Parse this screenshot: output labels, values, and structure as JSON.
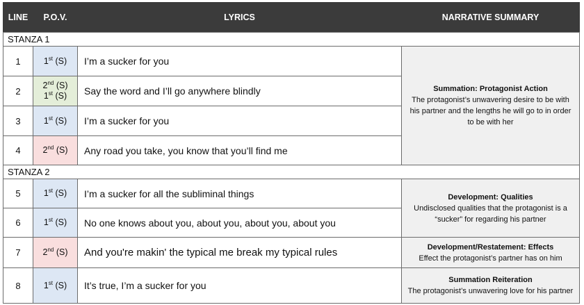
{
  "headers": {
    "line": "LINE",
    "pov": "P.O.V.",
    "lyrics": "LYRICS",
    "summary": "NARRATIVE SUMMARY"
  },
  "stanzas": [
    {
      "label": "STANZA 1"
    },
    {
      "label": "STANZA 2"
    }
  ],
  "rows": [
    {
      "num": "1",
      "pov": [
        {
          "n": "1",
          "sup": "st",
          "s": "(S)"
        }
      ],
      "lyric": "I’m a sucker for you"
    },
    {
      "num": "2",
      "pov": [
        {
          "n": "2",
          "sup": "nd",
          "s": "(S)"
        },
        {
          "n": "1",
          "sup": "st",
          "s": "(S)"
        }
      ],
      "lyric": "Say the word and I’ll go anywhere blindly"
    },
    {
      "num": "3",
      "pov": [
        {
          "n": "1",
          "sup": "st",
          "s": "(S)"
        }
      ],
      "lyric": "I’m a sucker for you"
    },
    {
      "num": "4",
      "pov": [
        {
          "n": "2",
          "sup": "nd",
          "s": "(S)"
        }
      ],
      "lyric": "Any road you take, you know that you’ll find me"
    },
    {
      "num": "5",
      "pov": [
        {
          "n": "1",
          "sup": "st",
          "s": "(S)"
        }
      ],
      "lyric": "I’m a sucker for all the subliminal things"
    },
    {
      "num": "6",
      "pov": [
        {
          "n": "1",
          "sup": "st",
          "s": "(S)"
        }
      ],
      "lyric": "No one knows about you, about you, about you, about you"
    },
    {
      "num": "7",
      "pov": [
        {
          "n": "2",
          "sup": "nd",
          "s": "(S)"
        }
      ],
      "lyric": "And you're makin' the typical me break my typical rules"
    },
    {
      "num": "8",
      "pov": [
        {
          "n": "1",
          "sup": "st",
          "s": "(S)"
        }
      ],
      "lyric": "It’s true, I’m a sucker for you"
    }
  ],
  "summaries": [
    {
      "title": "Summation: Protagonist Action",
      "body": "The protagonist’s unwavering desire to be with his partner and the lengths he will go to in order to be with her"
    },
    {
      "title": "Development: Qualities",
      "body": "Undisclosed qualities that the protagonist is a “sucker” for regarding his partner"
    },
    {
      "title": "Development/Restatement: Effects",
      "body": "Effect the protagonist’s partner has on him"
    },
    {
      "title": "Summation Reiteration",
      "body": "The protagonist’s unwavering love for his partner"
    }
  ]
}
